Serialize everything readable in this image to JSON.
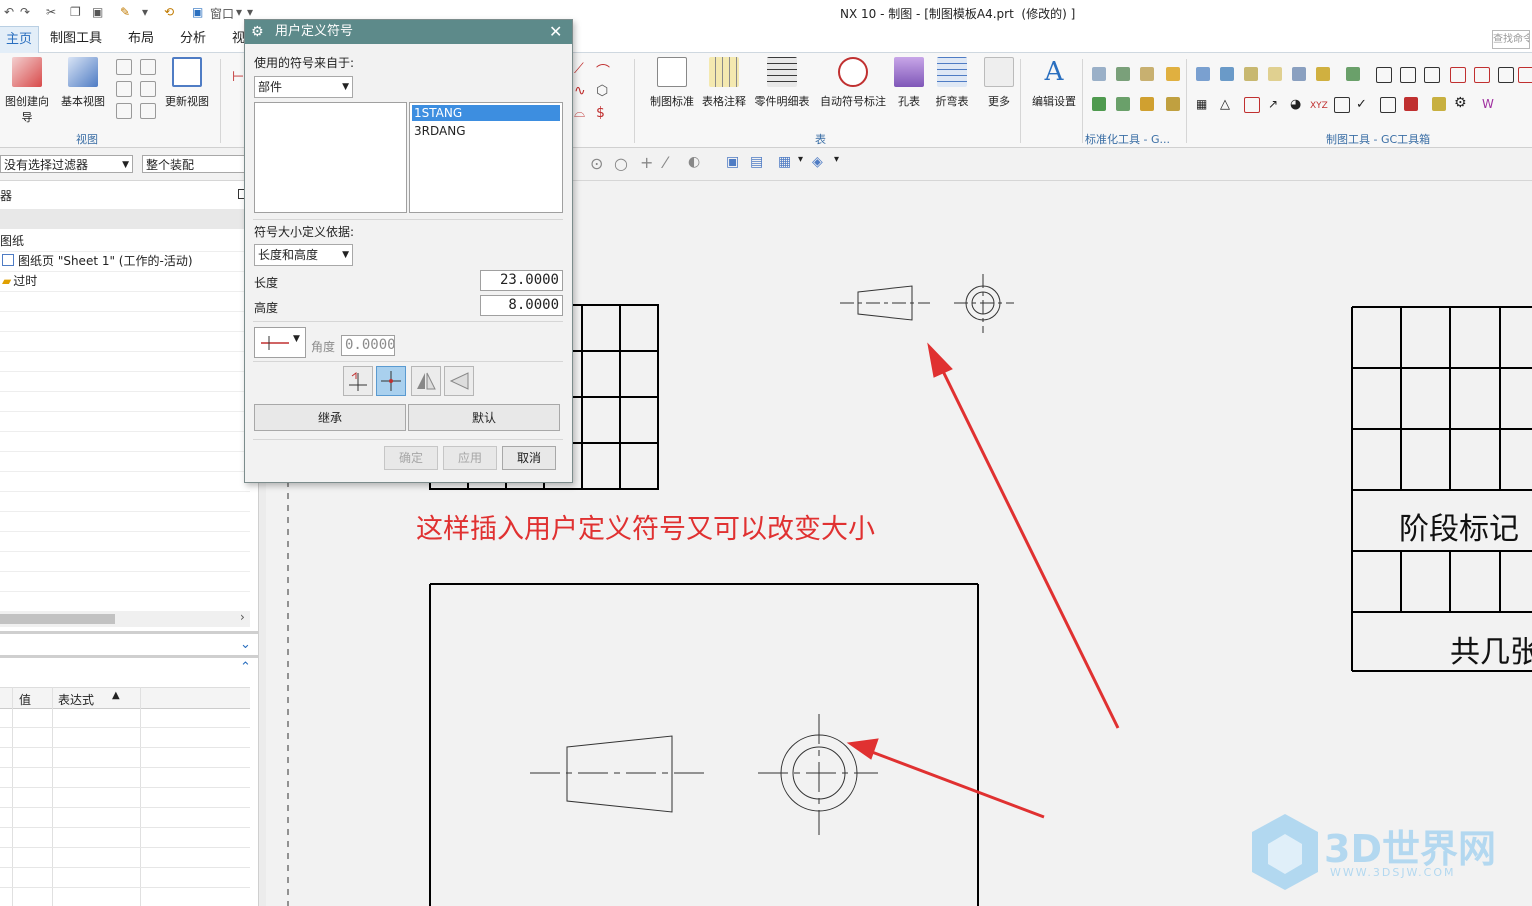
{
  "window": {
    "title": "NX 10 - 制图 - [制图模板A4.prt  (修改的) ]",
    "menu_window": "窗口"
  },
  "tabs": [
    {
      "label": "主页"
    },
    {
      "label": "制图工具"
    },
    {
      "label": "布局"
    },
    {
      "label": "分析"
    },
    {
      "label": "视"
    }
  ],
  "search_placeholder": "查找命令",
  "ribbon": {
    "view_buttons": [
      "图创建向导",
      "基本视图",
      "更新视图"
    ],
    "view_group": "视图",
    "table_buttons": [
      "制图标准",
      "表格注释",
      "零件明细表",
      "自动符号标注",
      "孔表",
      "折弯表",
      "更多"
    ],
    "table_group": "表",
    "edit_settings": "编辑设置",
    "std_group": "标准化工具 - G...",
    "gc_group": "制图工具 - GC工具箱",
    "xyz_label": "XYZ"
  },
  "selbar": {
    "filter": "没有选择过滤器",
    "scope": "整个装配"
  },
  "navigator": {
    "header_char": "器",
    "drawing": "图纸",
    "sheet_page": "图纸页 \"Sheet 1\" (工作的-活动)",
    "outdated": "过时",
    "col_value": "值",
    "col_expression": "表达式"
  },
  "dialog": {
    "title": "用户定义符号",
    "source_label": "使用的符号来自于:",
    "source_value": "部件",
    "symbols": [
      "1STANG",
      "3RDANG"
    ],
    "selected_symbol": "1STANG",
    "size_label": "符号大小定义依据:",
    "size_value": "长度和高度",
    "length_label": "长度",
    "length_value": "23.0000",
    "height_label": "高度",
    "height_value": "8.0000",
    "angle_label": "角度",
    "angle_value": "0.0000",
    "inherit_button": "继承",
    "default_button": "默认",
    "ok_button": "确定",
    "apply_button": "应用",
    "cancel_button": "取消"
  },
  "canvas": {
    "annotation": "这样插入用户定义符号又可以改变大小",
    "stage_mark": "阶段标记",
    "total_sheets": "共几张",
    "watermark": "3D世界网",
    "watermark_url": "WWW.3DSJW.COM"
  },
  "colors": {
    "accent": "#2a6fbf",
    "dialog_title": "#5d8a8a",
    "annotation": "#e03131",
    "selection": "#3d8ee0"
  }
}
